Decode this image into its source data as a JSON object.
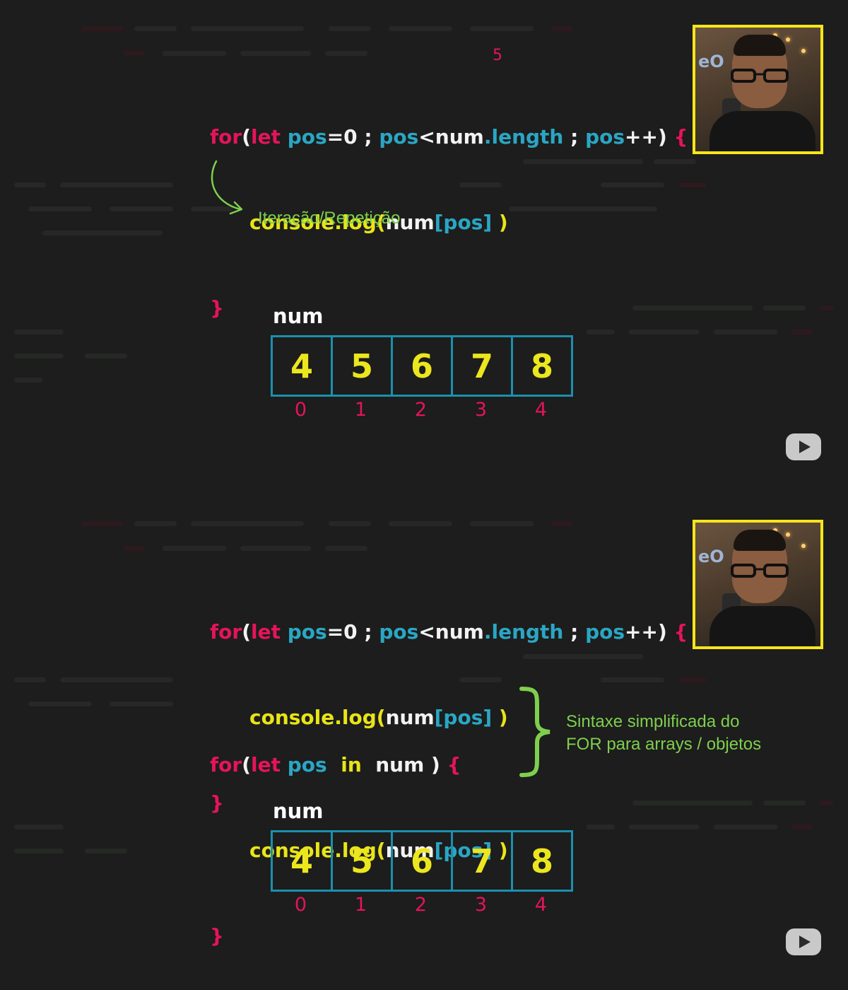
{
  "top": {
    "annotation_number": "5",
    "code": {
      "line1": {
        "kw_for": "for",
        "paren_open": "(",
        "kw_let": "let",
        "var1": "pos",
        "op1": "=0",
        "sep1": " ; ",
        "var2": "pos",
        "op2": "<num",
        "prop": ".length",
        "sep2": " ; ",
        "var3": "pos",
        "op3": "++",
        "paren_close": ") ",
        "brace_open": "{"
      },
      "line2": {
        "call": "console.log(",
        "arr": "num",
        "bracket": "[pos]",
        "close": " )"
      },
      "line3": {
        "brace_close": "}"
      }
    },
    "note": "Iteração/Repetição",
    "array": {
      "name": "num",
      "values": [
        "4",
        "5",
        "6",
        "7",
        "8"
      ],
      "indexes": [
        "0",
        "1",
        "2",
        "3",
        "4"
      ]
    }
  },
  "bottom": {
    "code1": {
      "line1": {
        "kw_for": "for",
        "paren_open": "(",
        "kw_let": "let",
        "var1": "pos",
        "op1": "=0",
        "sep1": " ; ",
        "var2": "pos",
        "op2": "<num",
        "prop": ".length",
        "sep2": " ; ",
        "var3": "pos",
        "op3": "++",
        "paren_close": ") ",
        "brace_open": "{"
      },
      "line2": {
        "call": "console.log(",
        "arr": "num",
        "bracket": "[pos]",
        "close": " )"
      },
      "line3": {
        "brace_close": "}"
      }
    },
    "code2": {
      "line1": {
        "kw_for": "for",
        "paren_open": "(",
        "kw_let": "let",
        "var1": "pos",
        "kw_in": "in",
        "arr": "num",
        "paren_close": " ) ",
        "brace_open": "{"
      },
      "line2": {
        "call": "console.log(",
        "arr": "num",
        "bracket": "[pos]",
        "close": " )"
      },
      "line3": {
        "brace_close": "}"
      }
    },
    "note_line1": "Sintaxe simplificada do",
    "note_line2": "FOR para arrays / objetos",
    "array": {
      "name": "num",
      "values": [
        "4",
        "5",
        "6",
        "7",
        "8"
      ],
      "indexes": [
        "0",
        "1",
        "2",
        "3",
        "4"
      ]
    }
  },
  "webcam_sign": "eO",
  "colors": {
    "keyword": "#e5145a",
    "identifier": "#2aa6c4",
    "function": "#e9e418",
    "note": "#7fcf4e",
    "frame": "#f7e51b",
    "array_border": "#1c8fae"
  },
  "icons": {
    "play": "play-icon",
    "arrow": "curved-arrow-icon",
    "brace": "curly-brace-icon"
  }
}
